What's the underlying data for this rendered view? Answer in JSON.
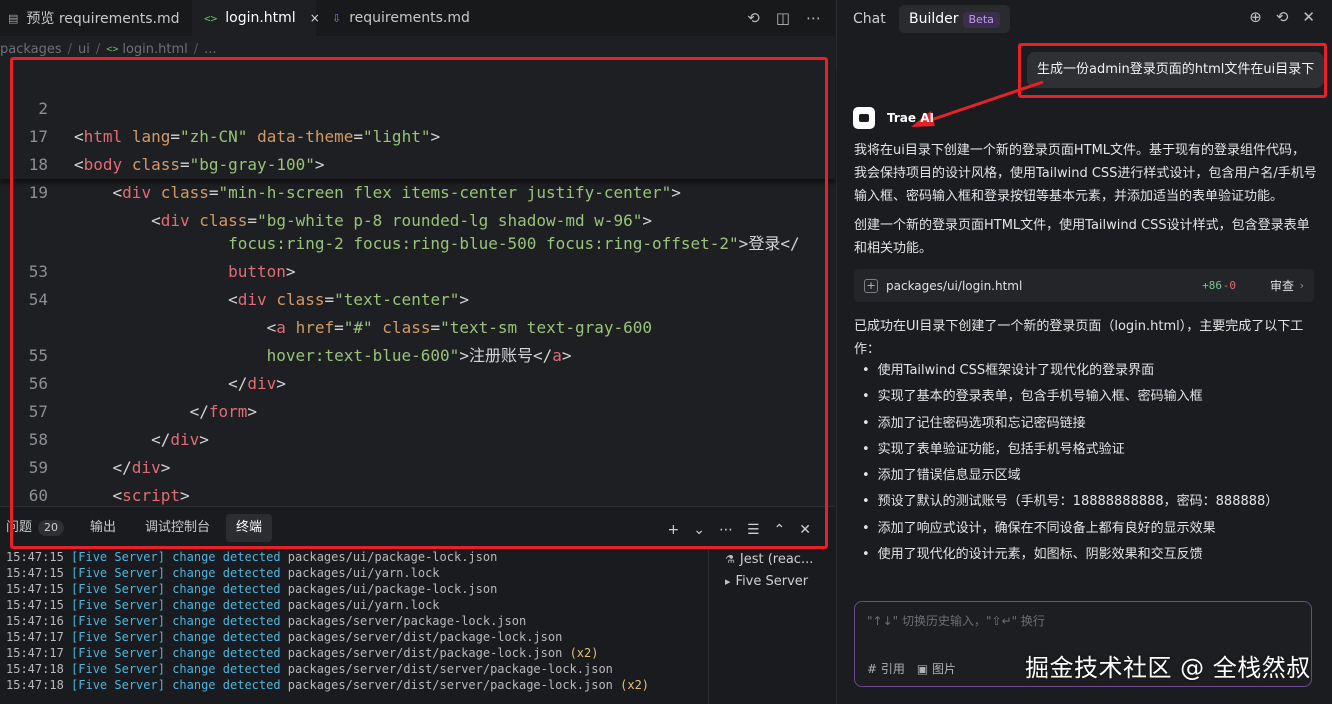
{
  "editor": {
    "tabs": [
      {
        "icon": "file-icon",
        "label": "预览 requirements.md"
      },
      {
        "icon": "html-icon",
        "label": "login.html",
        "close": "×"
      },
      {
        "icon": "markdown-icon",
        "label": "requirements.md"
      }
    ],
    "breadcrumb": [
      "packages",
      "ui",
      "login.html",
      "..."
    ],
    "lines": [
      {
        "n": "2",
        "sticky": true
      },
      {
        "n": "17",
        "sticky": true
      },
      {
        "n": "18",
        "sticky": true
      },
      {
        "n": "19",
        "sticky": true
      },
      {
        "n": "",
        "text": "focus:ring-2 focus:ring-blue-500 focus:ring-offset-2\">登录</"
      },
      {
        "n": "",
        "text": "button>"
      },
      {
        "n": "53"
      },
      {
        "n": "54"
      },
      {
        "n": "",
        "text": "hover:text-blue-600\">注册账号</a>"
      },
      {
        "n": "55"
      },
      {
        "n": "56"
      },
      {
        "n": "57"
      },
      {
        "n": "58"
      },
      {
        "n": "59"
      },
      {
        "n": "60"
      }
    ]
  },
  "panel": {
    "tabs": [
      "问题",
      "输出",
      "调试控制台",
      "终端"
    ],
    "problem_count": "20",
    "terminal_lines": [
      {
        "time": "15:47:15",
        "tag": "[Five Server]",
        "path": "packages/ui/package-lock.json",
        "x": ""
      },
      {
        "time": "15:47:15",
        "tag": "[Five Server]",
        "path": "packages/ui/yarn.lock",
        "x": ""
      },
      {
        "time": "15:47:15",
        "tag": "[Five Server]",
        "path": "packages/ui/package-lock.json",
        "x": ""
      },
      {
        "time": "15:47:15",
        "tag": "[Five Server]",
        "path": "packages/ui/yarn.lock",
        "x": ""
      },
      {
        "time": "15:47:16",
        "tag": "[Five Server]",
        "path": "packages/server/package-lock.json",
        "x": ""
      },
      {
        "time": "15:47:17",
        "tag": "[Five Server]",
        "path": "packages/server/dist/package-lock.json",
        "x": ""
      },
      {
        "time": "15:47:17",
        "tag": "[Five Server]",
        "path": "packages/server/dist/package-lock.json",
        "x": "(x2)"
      },
      {
        "time": "15:47:18",
        "tag": "[Five Server]",
        "path": "packages/server/dist/server/package-lock.json",
        "x": ""
      },
      {
        "time": "15:47:18",
        "tag": "[Five Server]",
        "path": "packages/server/dist/server/package-lock.json",
        "x": "(x2)"
      }
    ],
    "change_word": "change",
    "detected_word": "detected",
    "terminals": [
      "Jest (reac...",
      "Five Server"
    ]
  },
  "chat": {
    "tabs": [
      "Chat",
      "Builder"
    ],
    "beta": "Beta",
    "user_message": "生成一份admin登录页面的html文件在ui目录下",
    "ai_name": "Trae AI",
    "para1": "我将在ui目录下创建一个新的登录页面HTML文件。基于现有的登录组件代码，我会保持项目的设计风格，使用Tailwind CSS进行样式设计，包含用户名/手机号输入框、密码输入框和登录按钮等基本元素，并添加适当的表单验证功能。",
    "para2": "创建一个新的登录页面HTML文件，使用Tailwind CSS设计样式，包含登录表单和相关功能。",
    "file": {
      "path": "packages/ui/login.html",
      "adds": "+86",
      "dels": "-0",
      "review": "审查"
    },
    "para3": "已成功在UI目录下创建了一个新的登录页面（login.html），主要完成了以下工作：",
    "bullets": [
      "使用Tailwind CSS框架设计了现代化的登录界面",
      "实现了基本的登录表单，包含手机号输入框、密码输入框",
      "添加了记住密码选项和忘记密码链接",
      "实现了表单验证功能，包括手机号格式验证",
      "添加了错误信息显示区域",
      "预设了默认的测试账号（手机号：18888888888，密码：888888）",
      "添加了响应式设计，确保在不同设备上都有良好的显示效果",
      "使用了现代化的设计元素，如图标、阴影效果和交互反馈"
    ],
    "input_placeholder": "\"↑↓\" 切换历史输入，\"⇧↵\" 换行",
    "cite": "# 引用",
    "image": "图片",
    "watermark": "掘金技术社区 @ 全栈然叔"
  },
  "colors": {
    "highlight_box": "#e8202a",
    "accent_purple": "#6b4a8e"
  }
}
